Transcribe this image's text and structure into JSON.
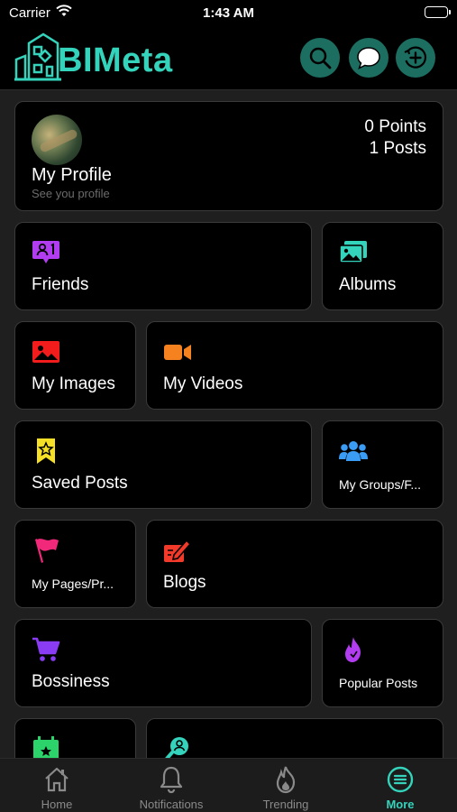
{
  "status_bar": {
    "carrier": "Carrier",
    "time": "1:43 AM"
  },
  "app": {
    "logo_text": "BIMeta",
    "accent": "#34d3bb"
  },
  "header_actions": [
    "search-icon",
    "chat-bubble-icon",
    "add-post-icon"
  ],
  "profile": {
    "name": "My Profile",
    "subtitle": "See you profile",
    "points": "0 Points",
    "posts": "1 Posts"
  },
  "menu": {
    "friends": {
      "label": "Friends",
      "icon": "friends-icon",
      "color": "#b23cf0"
    },
    "albums": {
      "label": "Albums",
      "icon": "albums-icon",
      "color": "#34d3bb"
    },
    "my_images": {
      "label": "My Images",
      "icon": "image-icon",
      "color": "#f21c1c"
    },
    "my_videos": {
      "label": "My Videos",
      "icon": "video-camera-icon",
      "color": "#f5821f"
    },
    "saved_posts": {
      "label": "Saved Posts",
      "icon": "bookmark-star-icon",
      "color": "#f5e027"
    },
    "my_groups": {
      "label": "My Groups/F...",
      "icon": "groups-icon",
      "color": "#3b9cf5"
    },
    "my_pages": {
      "label": "My Pages/Pr...",
      "icon": "flag-icon",
      "color": "#f2297a"
    },
    "blogs": {
      "label": "Blogs",
      "icon": "blog-edit-icon",
      "color": "#f23a2a"
    },
    "bossiness": {
      "label": "Bossiness",
      "icon": "cart-icon",
      "color": "#8a3cf5"
    },
    "popular_posts": {
      "label": "Popular Posts",
      "icon": "flame-icon",
      "color": "#b23cf0"
    },
    "events": {
      "label": "",
      "icon": "calendar-star-icon",
      "color": "#2bd36a"
    },
    "find_friends": {
      "label": "",
      "icon": "search-user-icon",
      "color": "#34d3bb"
    }
  },
  "tabs": [
    {
      "label": "Home",
      "icon": "home-icon"
    },
    {
      "label": "Notifications",
      "icon": "bell-icon"
    },
    {
      "label": "Trending",
      "icon": "flame-icon"
    },
    {
      "label": "More",
      "icon": "more-icon",
      "active": true
    }
  ]
}
